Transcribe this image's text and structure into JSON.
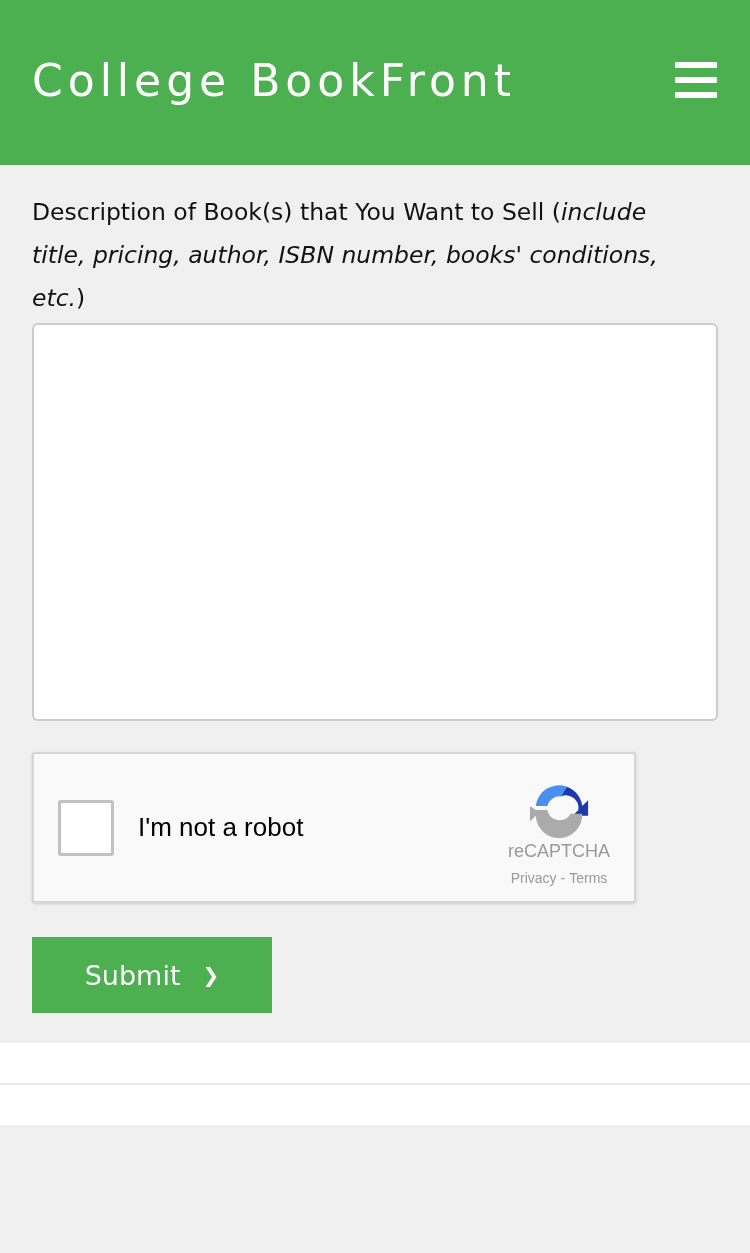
{
  "header": {
    "title": "College BookFront"
  },
  "form": {
    "label": "Description of Book(s) that You Want to Sell (*include title, pricing, author, ISBN number, books' conditions, etc.*)",
    "captcha": {
      "label": "I'm not a robot",
      "checked": false,
      "brand": "reCAPTCHA",
      "privacy": "Privacy",
      "separator": "-",
      "terms": "Terms"
    },
    "submit": {
      "label": "Submit",
      "arrow": "❯"
    }
  }
}
